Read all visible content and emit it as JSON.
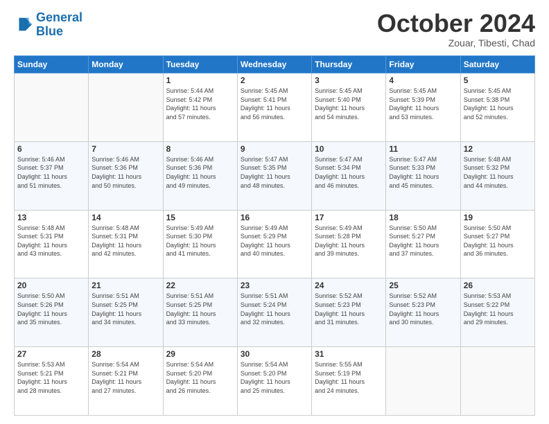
{
  "logo": {
    "line1": "General",
    "line2": "Blue"
  },
  "header": {
    "month": "October 2024",
    "location": "Zouar, Tibesti, Chad"
  },
  "weekdays": [
    "Sunday",
    "Monday",
    "Tuesday",
    "Wednesday",
    "Thursday",
    "Friday",
    "Saturday"
  ],
  "weeks": [
    [
      {
        "day": "",
        "info": ""
      },
      {
        "day": "",
        "info": ""
      },
      {
        "day": "1",
        "info": "Sunrise: 5:44 AM\nSunset: 5:42 PM\nDaylight: 11 hours\nand 57 minutes."
      },
      {
        "day": "2",
        "info": "Sunrise: 5:45 AM\nSunset: 5:41 PM\nDaylight: 11 hours\nand 56 minutes."
      },
      {
        "day": "3",
        "info": "Sunrise: 5:45 AM\nSunset: 5:40 PM\nDaylight: 11 hours\nand 54 minutes."
      },
      {
        "day": "4",
        "info": "Sunrise: 5:45 AM\nSunset: 5:39 PM\nDaylight: 11 hours\nand 53 minutes."
      },
      {
        "day": "5",
        "info": "Sunrise: 5:45 AM\nSunset: 5:38 PM\nDaylight: 11 hours\nand 52 minutes."
      }
    ],
    [
      {
        "day": "6",
        "info": "Sunrise: 5:46 AM\nSunset: 5:37 PM\nDaylight: 11 hours\nand 51 minutes."
      },
      {
        "day": "7",
        "info": "Sunrise: 5:46 AM\nSunset: 5:36 PM\nDaylight: 11 hours\nand 50 minutes."
      },
      {
        "day": "8",
        "info": "Sunrise: 5:46 AM\nSunset: 5:36 PM\nDaylight: 11 hours\nand 49 minutes."
      },
      {
        "day": "9",
        "info": "Sunrise: 5:47 AM\nSunset: 5:35 PM\nDaylight: 11 hours\nand 48 minutes."
      },
      {
        "day": "10",
        "info": "Sunrise: 5:47 AM\nSunset: 5:34 PM\nDaylight: 11 hours\nand 46 minutes."
      },
      {
        "day": "11",
        "info": "Sunrise: 5:47 AM\nSunset: 5:33 PM\nDaylight: 11 hours\nand 45 minutes."
      },
      {
        "day": "12",
        "info": "Sunrise: 5:48 AM\nSunset: 5:32 PM\nDaylight: 11 hours\nand 44 minutes."
      }
    ],
    [
      {
        "day": "13",
        "info": "Sunrise: 5:48 AM\nSunset: 5:31 PM\nDaylight: 11 hours\nand 43 minutes."
      },
      {
        "day": "14",
        "info": "Sunrise: 5:48 AM\nSunset: 5:31 PM\nDaylight: 11 hours\nand 42 minutes."
      },
      {
        "day": "15",
        "info": "Sunrise: 5:49 AM\nSunset: 5:30 PM\nDaylight: 11 hours\nand 41 minutes."
      },
      {
        "day": "16",
        "info": "Sunrise: 5:49 AM\nSunset: 5:29 PM\nDaylight: 11 hours\nand 40 minutes."
      },
      {
        "day": "17",
        "info": "Sunrise: 5:49 AM\nSunset: 5:28 PM\nDaylight: 11 hours\nand 39 minutes."
      },
      {
        "day": "18",
        "info": "Sunrise: 5:50 AM\nSunset: 5:27 PM\nDaylight: 11 hours\nand 37 minutes."
      },
      {
        "day": "19",
        "info": "Sunrise: 5:50 AM\nSunset: 5:27 PM\nDaylight: 11 hours\nand 36 minutes."
      }
    ],
    [
      {
        "day": "20",
        "info": "Sunrise: 5:50 AM\nSunset: 5:26 PM\nDaylight: 11 hours\nand 35 minutes."
      },
      {
        "day": "21",
        "info": "Sunrise: 5:51 AM\nSunset: 5:25 PM\nDaylight: 11 hours\nand 34 minutes."
      },
      {
        "day": "22",
        "info": "Sunrise: 5:51 AM\nSunset: 5:25 PM\nDaylight: 11 hours\nand 33 minutes."
      },
      {
        "day": "23",
        "info": "Sunrise: 5:51 AM\nSunset: 5:24 PM\nDaylight: 11 hours\nand 32 minutes."
      },
      {
        "day": "24",
        "info": "Sunrise: 5:52 AM\nSunset: 5:23 PM\nDaylight: 11 hours\nand 31 minutes."
      },
      {
        "day": "25",
        "info": "Sunrise: 5:52 AM\nSunset: 5:23 PM\nDaylight: 11 hours\nand 30 minutes."
      },
      {
        "day": "26",
        "info": "Sunrise: 5:53 AM\nSunset: 5:22 PM\nDaylight: 11 hours\nand 29 minutes."
      }
    ],
    [
      {
        "day": "27",
        "info": "Sunrise: 5:53 AM\nSunset: 5:21 PM\nDaylight: 11 hours\nand 28 minutes."
      },
      {
        "day": "28",
        "info": "Sunrise: 5:54 AM\nSunset: 5:21 PM\nDaylight: 11 hours\nand 27 minutes."
      },
      {
        "day": "29",
        "info": "Sunrise: 5:54 AM\nSunset: 5:20 PM\nDaylight: 11 hours\nand 26 minutes."
      },
      {
        "day": "30",
        "info": "Sunrise: 5:54 AM\nSunset: 5:20 PM\nDaylight: 11 hours\nand 25 minutes."
      },
      {
        "day": "31",
        "info": "Sunrise: 5:55 AM\nSunset: 5:19 PM\nDaylight: 11 hours\nand 24 minutes."
      },
      {
        "day": "",
        "info": ""
      },
      {
        "day": "",
        "info": ""
      }
    ]
  ]
}
